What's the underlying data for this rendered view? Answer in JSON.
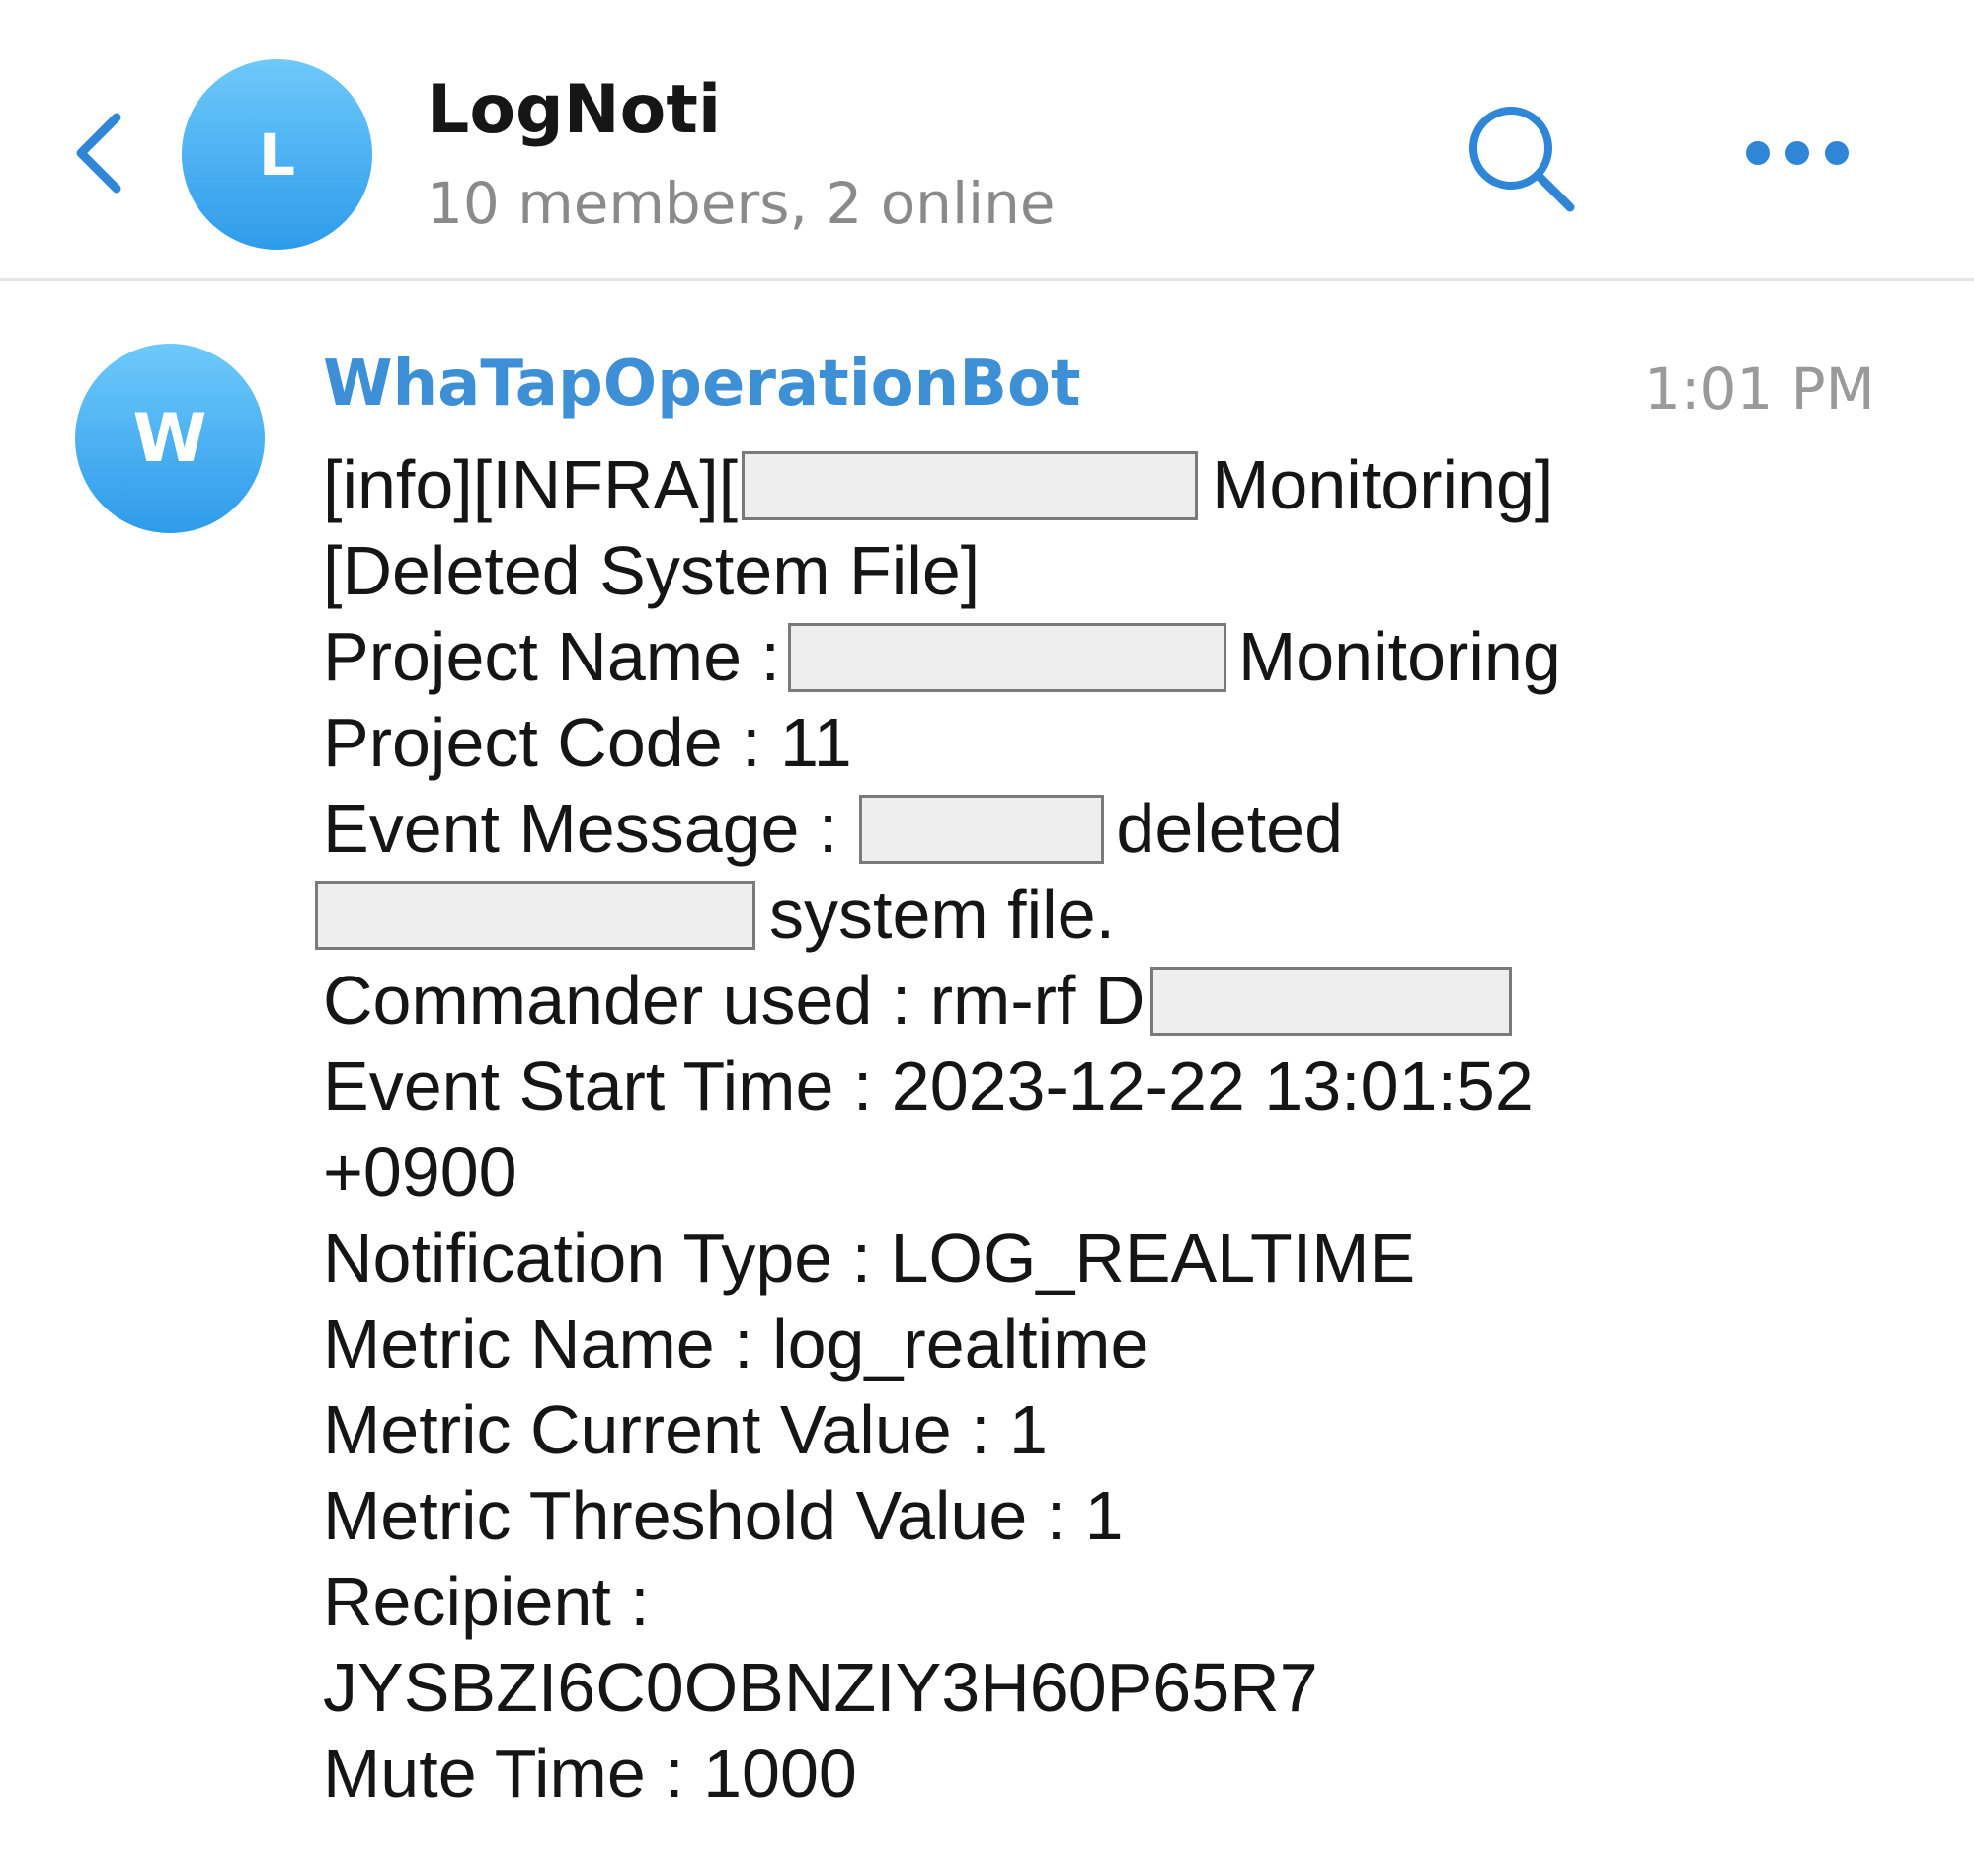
{
  "header": {
    "back_icon": "chevron-left-icon",
    "avatar_letter": "L",
    "title": "LogNoti",
    "subtitle": "10 members, 2 online",
    "search_icon": "search-icon",
    "more_icon": "more-horizontal-icon"
  },
  "message": {
    "avatar_letter": "W",
    "sender": "WhaTapOperationBot",
    "time": "1:01 PM",
    "lines": {
      "l0_a": "[info][INFRA][",
      "l0_b": "Monitoring]",
      "l1": "[Deleted System File]",
      "l2_a": "Project Name :",
      "l2_b": "Monitoring",
      "l3": "Project Code : 11",
      "l4_a": "Event Message :",
      "l4_b": "deleted",
      "l5": "system file.",
      "l6": "Commander used : rm-rf D",
      "l7": "Event Start Time : 2023-12-22 13:01:52",
      "l8": "+0900",
      "l9": "Notification Type : LOG_REALTIME",
      "l10": "Metric Name : log_realtime",
      "l11": "Metric Current Value : 1",
      "l12": "Metric Threshold Value : 1",
      "l13": "Recipient :",
      "l14": "JYSBZI6C0OBNZIY3H60P65R7",
      "l15": "Mute Time : 1000"
    }
  },
  "colors": {
    "accent": "#3d8fd6",
    "avatar_gradient_top": "#6ec9fb",
    "avatar_gradient_bottom": "#2e9bea",
    "muted_text": "#8a8a8a"
  }
}
